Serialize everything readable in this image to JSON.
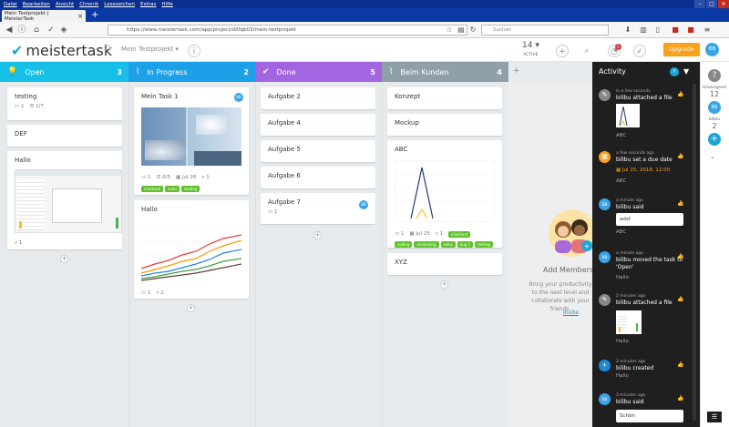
{
  "browser": {
    "menu": [
      "Datei",
      "Bearbeiten",
      "Ansicht",
      "Chronik",
      "Lesezeichen",
      "Extras",
      "Hilfe"
    ],
    "tab_title": "Mein Testprojekt | MeisterTask",
    "url": "https://www.meistertask.com/app/project/dXfqb03/mein-testprojekt",
    "search_placeholder": "Suchen"
  },
  "header": {
    "logo": "meistertask",
    "project": "Mein Testprojekt",
    "active_count": "14",
    "active_label": "ACTIVE",
    "notification_count": "1",
    "upgrade_label": "Upgrade",
    "user_initials": "BB"
  },
  "columns": [
    {
      "name": "Open",
      "count": "3",
      "color": "#16bfe6",
      "icon": "lightbulb-icon"
    },
    {
      "name": "In Progress",
      "count": "2",
      "color": "#1ca0e8",
      "icon": "pulse-icon"
    },
    {
      "name": "Done",
      "count": "5",
      "color": "#a366e0",
      "icon": "check-circle-icon"
    },
    {
      "name": "Beim Kunden",
      "count": "4",
      "color": "#8fa0a8",
      "icon": "pulse-icon"
    }
  ],
  "cards": {
    "open": [
      {
        "title": "testing",
        "comments": "1",
        "checklist": "1/7"
      },
      {
        "title": "DEF"
      },
      {
        "title": "Hallo",
        "attachments": "1"
      }
    ],
    "in_progress": [
      {
        "title": "Mein Task 1",
        "avatar": "BB",
        "comments": "1",
        "checklist": "0/5",
        "due": "Jul 26",
        "attachments": "1",
        "tags": [
          "checkout",
          "sales",
          "testing"
        ]
      },
      {
        "title": "Hallo",
        "comments": "1",
        "attachments": "2"
      }
    ],
    "done": [
      {
        "title": "Aufgabe 2"
      },
      {
        "title": "Aufgabe 4"
      },
      {
        "title": "Aufgabe 5"
      },
      {
        "title": "Aufgabe 6"
      },
      {
        "title": "Aufgabe 7",
        "avatar": "BB",
        "comments": "1"
      }
    ],
    "beim_kunden": [
      {
        "title": "Konzept"
      },
      {
        "title": "Mockup"
      },
      {
        "title": "ABC",
        "comments": "1",
        "due": "Jul 25",
        "attachments": "1",
        "tags": [
          "checkout",
          "coding",
          "evaluating",
          "sales",
          "bug 1",
          "testing"
        ]
      },
      {
        "title": "XYZ"
      }
    ]
  },
  "add_members": {
    "title": "Add Members",
    "description": "Bring your productivity to the next level and collaborate with your friends.",
    "invite": "Invite"
  },
  "activity": {
    "title": "Activity",
    "items": [
      {
        "time": "in a few seconds",
        "text": "bilibu attached a file",
        "sub": "ABC",
        "icon": "paperclip-icon",
        "color": "#888888"
      },
      {
        "time": "a few seconds ago",
        "text": "bilibu set a due date",
        "due": "Jul 25, 2018, 12:00",
        "sub": "ABC",
        "icon": "calendar-icon",
        "color": "#f7a11c"
      },
      {
        "time": "a minute ago",
        "text": "bilibu said",
        "box": "adsf",
        "sub": "ABC",
        "icon": "avatar-icon",
        "color": "#3aa5e6"
      },
      {
        "time": "a minute ago",
        "text": "bilibu moved the task to 'Open'",
        "sub": "Hallo",
        "icon": "avatar-icon",
        "color": "#3aa5e6"
      },
      {
        "time": "2 minutes ago",
        "text": "bilibu attached a file",
        "sub": "Hallo",
        "icon": "paperclip-icon",
        "color": "#888888"
      },
      {
        "time": "2 minutes ago",
        "text": "bilibu created",
        "sub": "Hallo",
        "icon": "plus-icon",
        "color": "#1a8bd8"
      },
      {
        "time": "3 minutes ago",
        "text": "bilibu said",
        "box": "Schön",
        "icon": "avatar-icon",
        "color": "#3aa5e6"
      }
    ]
  },
  "strip": {
    "unassigned_label": "Unassigned",
    "unassigned_count": "12",
    "user_label": "bilibu",
    "user_count": "2",
    "user_initials": "BB"
  }
}
